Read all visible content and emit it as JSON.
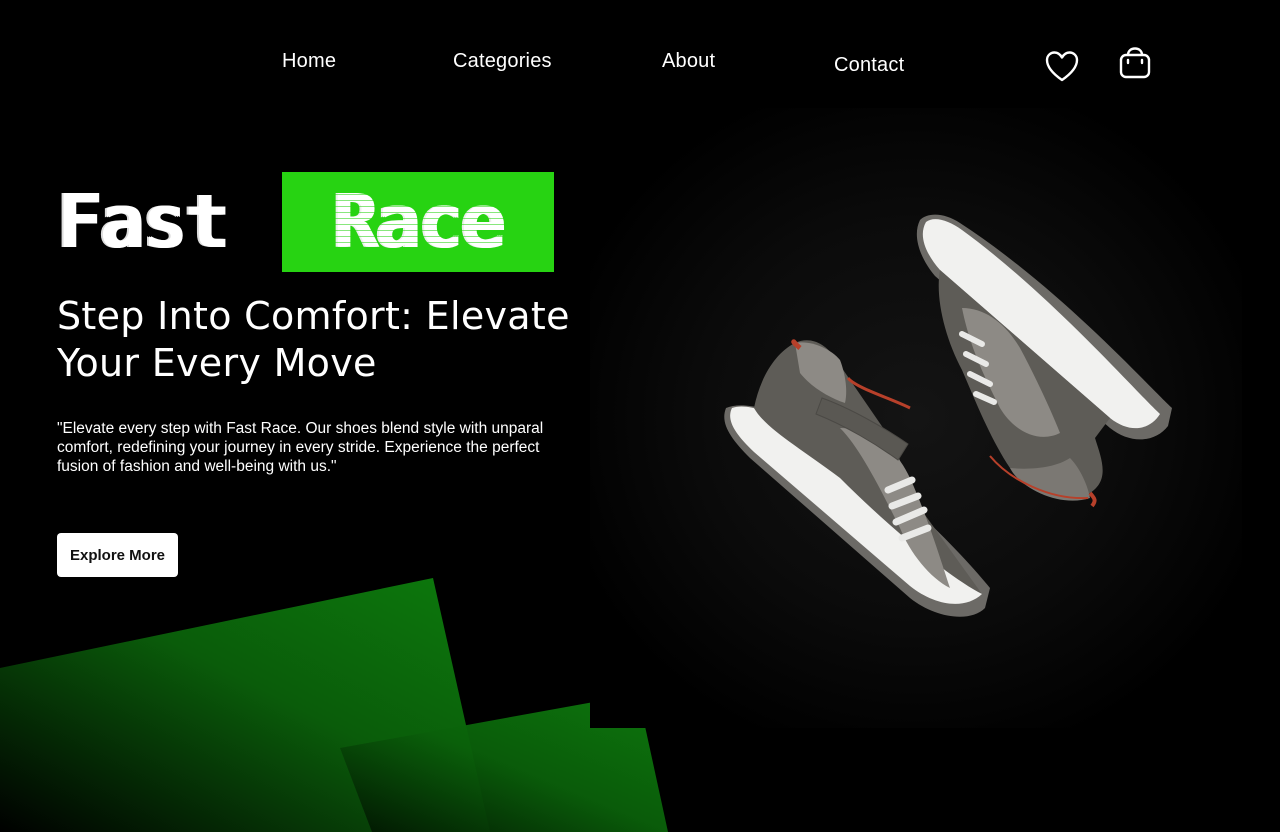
{
  "nav": {
    "items": [
      {
        "label": "Home"
      },
      {
        "label": "Categories"
      },
      {
        "label": "About"
      },
      {
        "label": "Contact"
      }
    ],
    "icons": [
      "heart-icon",
      "shopping-bag-icon"
    ]
  },
  "brand": {
    "word1": "Fast",
    "word2": "Race",
    "accent_color": "#27d312"
  },
  "hero": {
    "headline_line1": "Step Into Comfort: Elevate",
    "headline_line2": "Your Every Move",
    "description_lines": [
      "\"Elevate every step with Fast Race. Our shoes blend style with unparal",
      "comfort, redefining your journey in every stride. Experience the perfect",
      "fusion of fashion and well-being with us.\""
    ],
    "cta_label": "Explore More"
  },
  "product": {
    "image": "pair-of-high-top-sneakers",
    "colors": {
      "suede": "#5e5c57",
      "fabric": "#8d8a85",
      "sole": "#f1f1ef",
      "accent": "#b7402a"
    }
  },
  "decor": {
    "green": "#0b6a0b"
  }
}
